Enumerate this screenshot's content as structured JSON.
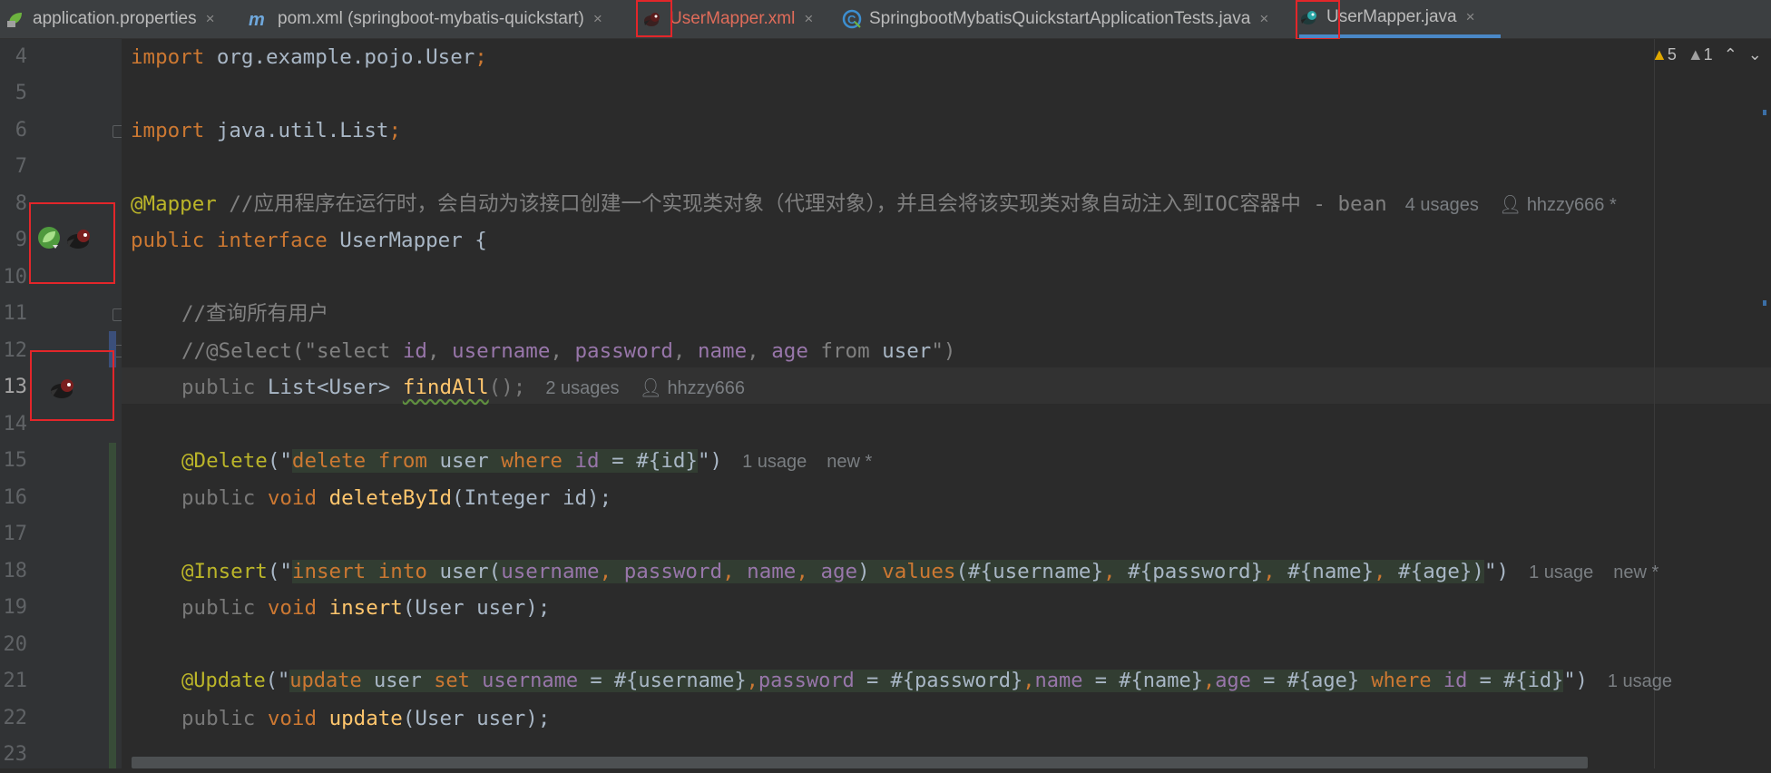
{
  "tabs": [
    {
      "label": "application.properties",
      "icon": "spring-properties-icon"
    },
    {
      "label": "pom.xml (springboot-mybatis-quickstart)",
      "icon": "maven-icon"
    },
    {
      "label": "UserMapper.xml",
      "icon": "mybatis-bird-icon"
    },
    {
      "label": "SpringbootMybatisQuickstartApplicationTests.java",
      "icon": "java-test-class-icon"
    },
    {
      "label": "UserMapper.java",
      "icon": "mybatis-bird-icon"
    }
  ],
  "close_glyph": "×",
  "inspections": {
    "warnings": "5",
    "weak_warnings": "1"
  },
  "line_numbers": [
    "4",
    "5",
    "6",
    "7",
    "8",
    "9",
    "10",
    "11",
    "12",
    "13",
    "14",
    "15",
    "16",
    "17",
    "18",
    "19",
    "20",
    "21",
    "22",
    "23"
  ],
  "code": {
    "l4": {
      "kw": "import",
      "rest": " org.example.pojo.User",
      "semi": ";"
    },
    "l6": {
      "kw": "import",
      "rest": " java.util.List",
      "semi": ";"
    },
    "l8": {
      "ann": "@Mapper",
      "cmt": " //应用程序在运行时，会自动为该接口创建一个实现类对象（代理对象），并且会将该实现类对象自动注入到IOC容器中 - bean",
      "usages": "4 usages",
      "author": "hhzzy666 *"
    },
    "l9": {
      "kw1": "public",
      "kw2": " interface",
      "name": " UserMapper {"
    },
    "l11": {
      "cmt": "//查询所有用户"
    },
    "l12": {
      "c1": "//@Select(\"select ",
      "f1": "id",
      "c2": ", ",
      "f2": "username",
      "c3": ", ",
      "f3": "password",
      "c4": ", ",
      "f4": "name",
      "c5": ", ",
      "f5": "age",
      "c6": " from ",
      "t": "user",
      "c7": "\")"
    },
    "l13": {
      "p1": "public ",
      "p2": "List<User> ",
      "fn": "findAll",
      "p3": "();",
      "usages": "2 usages",
      "author": "hhzzy666"
    },
    "l15": {
      "ann": "@Delete",
      "p1": "(\"",
      "k1": "delete from",
      "t1": " user ",
      "k2": "where",
      "f1": " id",
      "t2": " = #{id}",
      "p2": "\")",
      "usages": "1 usage",
      "status": "new *"
    },
    "l16": {
      "p1": "public ",
      "kw": "void ",
      "fn": "deleteById",
      "p2": "(Integer id);"
    },
    "l18": {
      "ann": "@Insert",
      "p1": "(\"",
      "k1": "insert into",
      "t1": " user(",
      "f1": "username",
      "c1": ", ",
      "f2": "password",
      "c2": ", ",
      "f3": "name",
      "c3": ", ",
      "f4": "age",
      "t2": ") ",
      "k2": "values",
      "t3": "(#{username}",
      "c4": ", ",
      "t4": "#{password}",
      "c5": ", ",
      "t5": "#{name}",
      "c6": ", ",
      "t6": "#{age})",
      "p2": "\")",
      "usages": "1 usage",
      "status": "new *"
    },
    "l19": {
      "p1": "public ",
      "kw": "void ",
      "fn": "insert",
      "p2": "(User user);"
    },
    "l21": {
      "ann": "@Update",
      "p1": "(\"",
      "k1": "update",
      "t1": " user ",
      "k2": "set",
      "f1": " username",
      "t2": " = #{username}",
      "c1": ",",
      "f2": "password",
      "t3": " = #{password}",
      "c2": ",",
      "f3": "name",
      "t4": " = #{name}",
      "c3": ",",
      "f4": "age",
      "t5": " = #{age} ",
      "k3": "where",
      "f5": " id",
      "t6": " = #{id}",
      "p2": "\")",
      "usages": "1 usage"
    },
    "l22": {
      "p1": "public ",
      "kw": "void ",
      "fn": "update",
      "p2": "(User user);"
    }
  }
}
